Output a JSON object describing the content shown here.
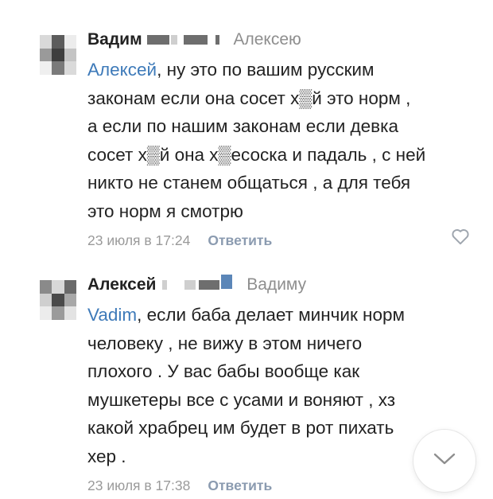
{
  "comments": [
    {
      "author": "Вадим",
      "reply_to": "Алексею",
      "mention": "Алексей",
      "lines": [
        ", ну это по вашим русским",
        "законам если она сосет х▒й это норм ,",
        "а если по нашим законам если девка",
        "сосет х▒й она х▒есоска и падаль , с ней",
        "никто не станем общаться , а для тебя",
        "это норм я смотрю"
      ],
      "date": "23 июля в 17:24",
      "reply_label": "Ответить"
    },
    {
      "author": "Алексей",
      "reply_to": "Вадиму",
      "mention": "Vadim",
      "lines": [
        ", если баба делает минчик норм",
        "человеку , не вижу в этом ничего",
        "плохого . У вас бабы вообще как",
        "мушкетеры все с усами и воняют , хз",
        "какой храбрец им будет в рот пихать",
        "хер ."
      ],
      "date": "23 июля в 17:38",
      "reply_label": "Ответить"
    }
  ],
  "icons": {
    "like": "heart-icon",
    "scroll": "chevron-down-icon"
  },
  "colors": {
    "mention": "#3e7ab9",
    "meta": "#9a9a9a",
    "reply_button": "#8b9bb0"
  }
}
